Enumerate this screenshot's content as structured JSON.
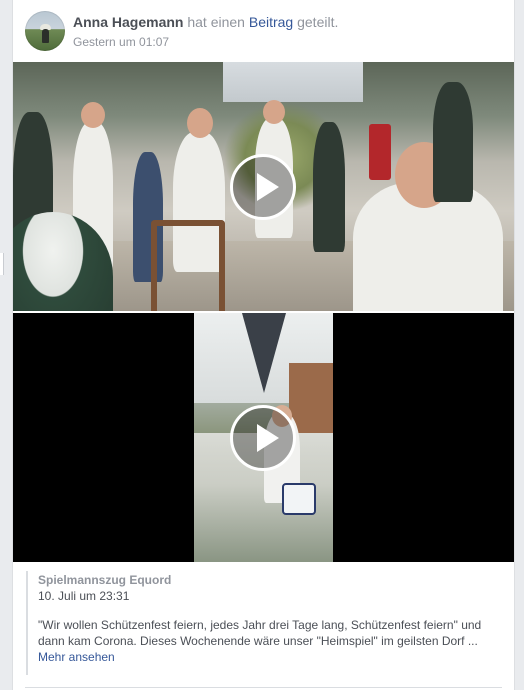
{
  "post": {
    "author": "Anna Hagemann",
    "action_prefix": " hat einen ",
    "link_text": "Beitrag",
    "action_suffix": " geteilt.",
    "timestamp": "Gestern um 01:07"
  },
  "shared": {
    "page_name": "Spielmannszug Equord",
    "date": "10. Juli um 23:31",
    "text": "\"Wir wollen Schützenfest feiern, jedes Jahr drei Tage lang, Schützenfest feiern\" und dann kam Corona. Dieses Wochenende wäre unser \"Heimspiel\" im geilsten Dorf ...",
    "more_label": "Mehr ansehen"
  },
  "icons": {
    "play": "play-icon",
    "avatar": "avatar"
  },
  "colors": {
    "background": "#e9ebee",
    "link": "#365899",
    "meta_text": "#90949c",
    "body_text": "#4b4f56"
  }
}
